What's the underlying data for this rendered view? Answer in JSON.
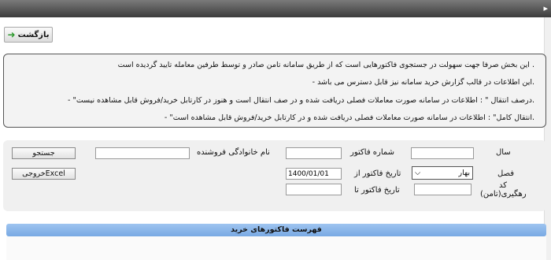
{
  "toolbar": {
    "back_label": "بازگشت"
  },
  "info": {
    "lines": [
      ". این بخش صرفا جهت سهولت در جستجوی فاکتورهایی است که از طریق سامانه تامن صادر  و توسط طرفین معامله تایید گردیده است",
      ".این اطلاعات در قالب گزارش خرید سامانه نیز قابل دسترس می باشد  -",
      ".درصف انتقال \" : اطلاعات در سامانه صورت معاملات فصلی دریافت شده و در صف انتقال است و هنوز در کارتابل خرید/فروش قابل مشاهده نیست\" -",
      ".انتقال کامل\"  :  اطلاعات در سامانه صورت معاملات فصلی دریافت شده و در کارتابل خرید/فروش قابل مشاهده است\" -"
    ]
  },
  "form": {
    "year_label": "سال",
    "year_value": "",
    "invoice_no_label": "شماره فاکتور",
    "invoice_no_value": "",
    "seller_label": "نام خانوادگی فروشنده",
    "seller_value": "",
    "search_button": "جستجو",
    "season_label": "فصل",
    "season_value": "بهار",
    "date_from_label": "تاریخ فاکتور از",
    "date_from_value": "1400/01/01",
    "excel_button": "خروجیExcel",
    "tracking_label_1": "کد",
    "tracking_label_2": "رهگیری(تامن)",
    "tracking_value": "",
    "date_to_label": "تاریخ فاکتور تا",
    "date_to_value": ""
  },
  "list": {
    "title": "فهرست فاکتورهای خرید"
  }
}
